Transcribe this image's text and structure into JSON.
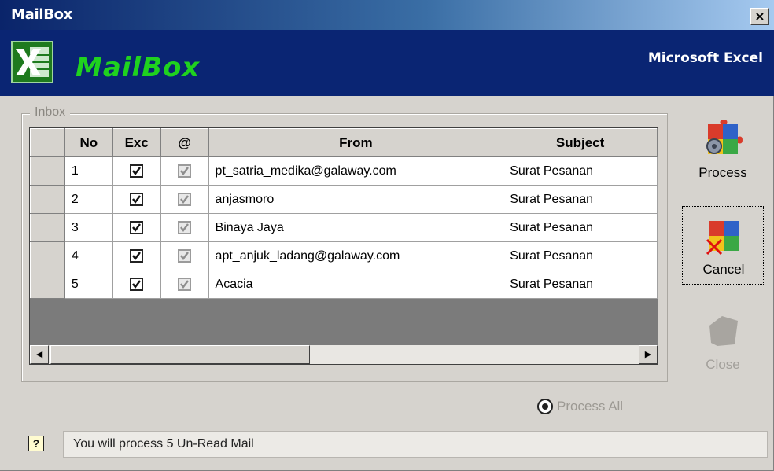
{
  "window": {
    "title": "MailBox",
    "close_label": "×"
  },
  "banner": {
    "app_name": "MailBox",
    "product": "Microsoft Excel",
    "logo_icon": "excel-icon"
  },
  "inbox": {
    "label": "Inbox",
    "columns": [
      "No",
      "Exc",
      "@",
      "From",
      "Subject"
    ],
    "rows": [
      {
        "no": "1",
        "exc": true,
        "read": true,
        "from": "pt_satria_medika@galaway.com",
        "subject": "Surat Pesanan"
      },
      {
        "no": "2",
        "exc": true,
        "read": true,
        "from": "anjasmoro",
        "subject": "Surat Pesanan"
      },
      {
        "no": "3",
        "exc": true,
        "read": true,
        "from": "Binaya Jaya",
        "subject": "Surat Pesanan"
      },
      {
        "no": "4",
        "exc": true,
        "read": true,
        "from": "apt_anjuk_ladang@galaway.com",
        "subject": "Surat Pesanan"
      },
      {
        "no": "5",
        "exc": true,
        "read": true,
        "from": "Acacia",
        "subject": "Surat Pesanan"
      }
    ],
    "scroll_left_glyph": "◀",
    "scroll_right_glyph": "▶"
  },
  "buttons": {
    "process": "Process",
    "cancel": "Cancel",
    "close": "Close"
  },
  "process_all": {
    "label": "Process All",
    "checked": true
  },
  "status": {
    "help_glyph": "?",
    "message": "You will process 5 Un-Read Mail"
  },
  "colors": {
    "banner": "#0a2573",
    "app_name": "#1fd21f",
    "face": "#d6d3ce",
    "grid_bg": "#7b7b7b"
  }
}
